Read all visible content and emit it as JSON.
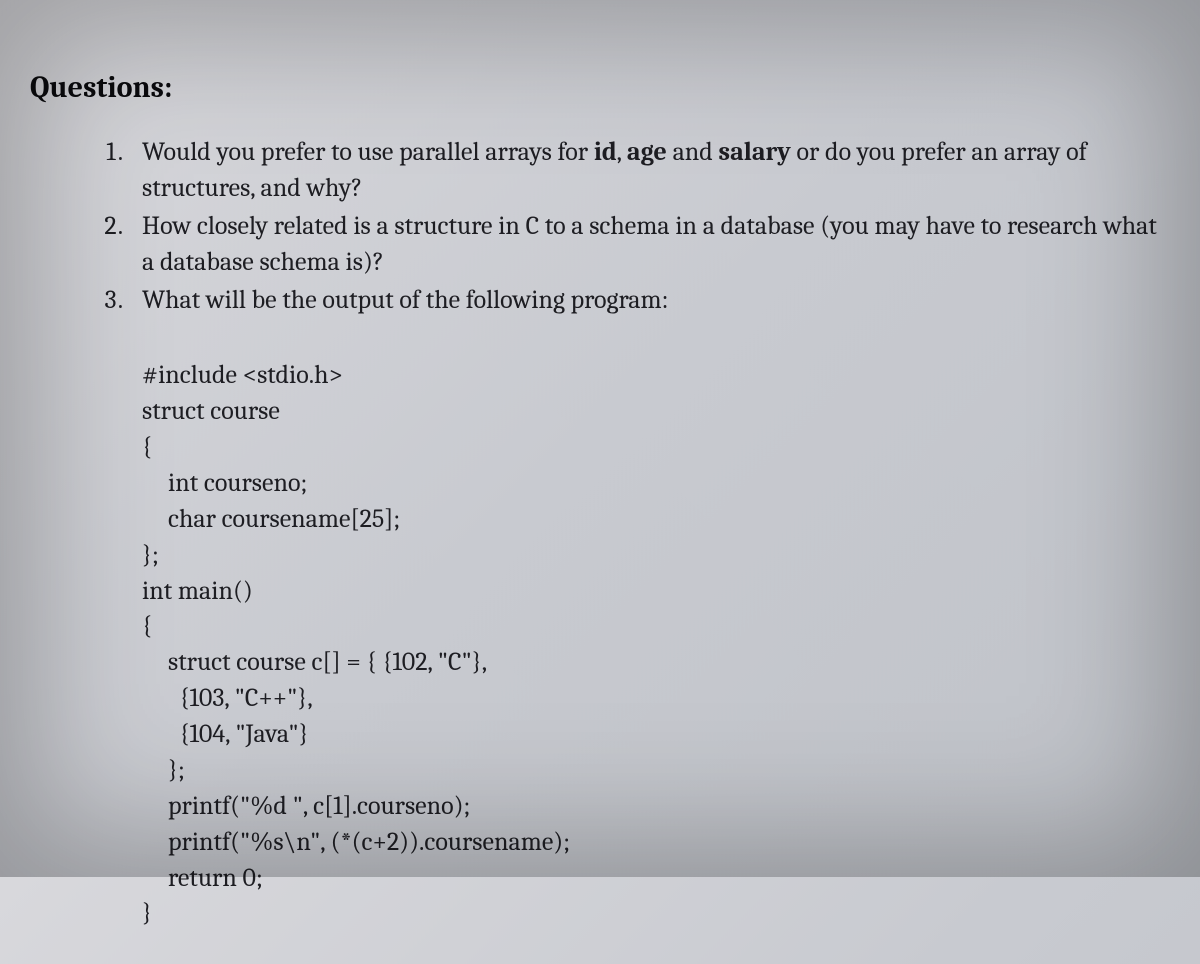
{
  "heading": "Questions:",
  "questions": {
    "q1": {
      "pre": "Would you prefer to use parallel arrays for ",
      "b1": "id",
      "mid1": ", ",
      "b2": "age",
      "mid2": " and ",
      "b3": "salary",
      "post": " or do you prefer an array of structures, and why?"
    },
    "q2": "How closely related is a structure in C to a schema in a database (you may have to research what a database schema is)?",
    "q3": {
      "prompt": "What will be the output of the following program:",
      "code": {
        "l01": "#include <stdio.h>",
        "l02": "struct course",
        "l03": "{",
        "l04": "int courseno;",
        "l05": "char coursename[25];",
        "l06": "};",
        "l07": "int main()",
        "l08": "{",
        "l09": "struct course c[] = { {102, \"C\"},",
        "l10": "  {103, \"C++\"},",
        "l11": "  {104, \"Java\"}",
        "l12": "};",
        "l13": "printf(\"%d \", c[1].courseno);",
        "l14": "printf(\"%s\\n\", (*(c+2)).coursename);",
        "l15": "return 0;",
        "l16": "}"
      }
    }
  }
}
